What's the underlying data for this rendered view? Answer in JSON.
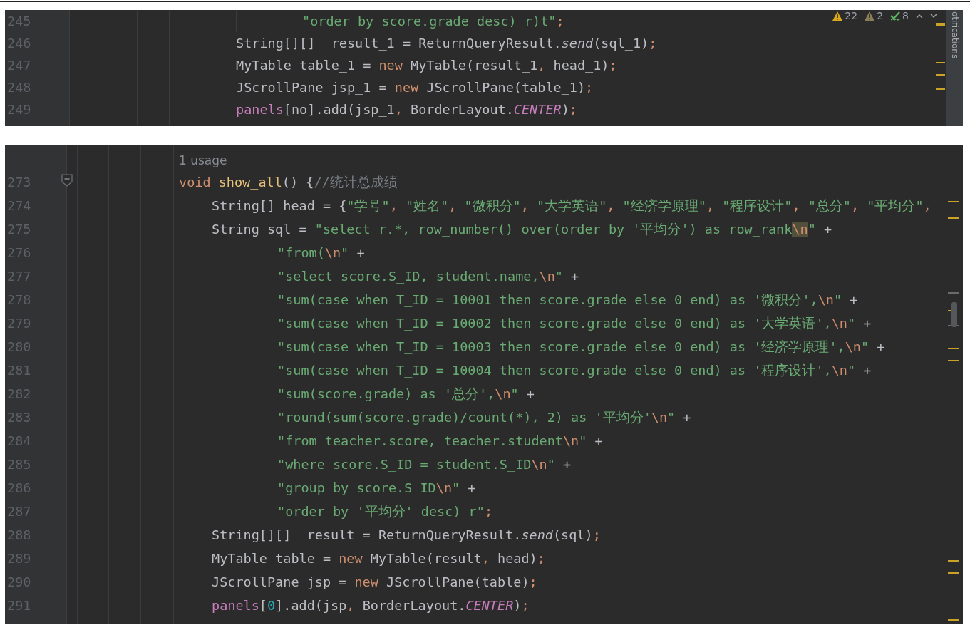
{
  "panels": [
    {
      "side_tab": "otifications",
      "inspections": [
        {
          "kind": "warning",
          "count": "22"
        },
        {
          "kind": "weak_warning",
          "count": "2"
        },
        {
          "kind": "typo",
          "count": "8"
        }
      ],
      "lines": [
        {
          "number": "245",
          "kind": "cont",
          "tokens": [
            {
              "text": "\"order by score.grade desc) r)t\"",
              "kind": "string"
            },
            {
              "text": ";",
              "kind": "punct"
            }
          ]
        },
        {
          "number": "246",
          "kind": "body",
          "tokens": [
            {
              "text": "String[][]  result_1 = ReturnQueryResult.",
              "kind": "plain"
            },
            {
              "text": "send",
              "kind": "static_call"
            },
            {
              "text": "(sql_1)",
              "kind": "plain"
            },
            {
              "text": ";",
              "kind": "punct"
            }
          ]
        },
        {
          "number": "247",
          "kind": "body",
          "tokens": [
            {
              "text": "MyTable table_1 = ",
              "kind": "plain"
            },
            {
              "text": "new",
              "kind": "keyword"
            },
            {
              "text": " MyTable(result_1",
              "kind": "plain"
            },
            {
              "text": ", ",
              "kind": "punct"
            },
            {
              "text": "head_1)",
              "kind": "plain"
            },
            {
              "text": ";",
              "kind": "punct"
            }
          ]
        },
        {
          "number": "248",
          "kind": "body",
          "tokens": [
            {
              "text": "JScrollPane jsp_1 = ",
              "kind": "plain"
            },
            {
              "text": "new",
              "kind": "keyword"
            },
            {
              "text": " JScrollPane(table_1)",
              "kind": "plain"
            },
            {
              "text": ";",
              "kind": "punct"
            }
          ]
        },
        {
          "number": "249",
          "kind": "body",
          "tokens": [
            {
              "text": "panels",
              "kind": "field"
            },
            {
              "text": "[no].add(jsp_1",
              "kind": "plain"
            },
            {
              "text": ", ",
              "kind": "punct"
            },
            {
              "text": "BorderLayout.",
              "kind": "plain"
            },
            {
              "text": "CENTER",
              "kind": "constant"
            },
            {
              "text": ")",
              "kind": "plain"
            },
            {
              "text": ";",
              "kind": "punct"
            }
          ]
        }
      ]
    },
    {
      "usage_hint": "1 usage",
      "lines": [
        {
          "number": "273",
          "kind": "decl",
          "tokens": [
            {
              "text": "void",
              "kind": "keyword"
            },
            {
              "text": " show_all",
              "kind": "function"
            },
            {
              "text": "() {",
              "kind": "plain"
            },
            {
              "text": "//统计总成绩",
              "kind": "comment"
            }
          ]
        },
        {
          "number": "274",
          "kind": "body",
          "tokens": [
            {
              "text": "String[] head = {",
              "kind": "plain"
            },
            {
              "text": "\"学号\"",
              "kind": "string"
            },
            {
              "text": ", ",
              "kind": "punct"
            },
            {
              "text": "\"姓名\"",
              "kind": "string"
            },
            {
              "text": ", ",
              "kind": "punct"
            },
            {
              "text": "\"微积分\"",
              "kind": "string"
            },
            {
              "text": ", ",
              "kind": "punct"
            },
            {
              "text": "\"大学英语\"",
              "kind": "string"
            },
            {
              "text": ", ",
              "kind": "punct"
            },
            {
              "text": "\"经济学原理\"",
              "kind": "string"
            },
            {
              "text": ", ",
              "kind": "punct"
            },
            {
              "text": "\"程序设计\"",
              "kind": "string"
            },
            {
              "text": ", ",
              "kind": "punct"
            },
            {
              "text": "\"总分\"",
              "kind": "string"
            },
            {
              "text": ", ",
              "kind": "punct"
            },
            {
              "text": "\"平均分\"",
              "kind": "string"
            },
            {
              "text": ",",
              "kind": "punct"
            }
          ]
        },
        {
          "number": "275",
          "kind": "body",
          "tokens": [
            {
              "text": "String sql = ",
              "kind": "plain"
            },
            {
              "text": "\"select r.*, row_number() over(order by '平均分') as row_rank",
              "kind": "string"
            },
            {
              "text": "\\n",
              "kind": "escape_match"
            },
            {
              "text": "\"",
              "kind": "string"
            },
            {
              "text": " +",
              "kind": "plain"
            }
          ]
        },
        {
          "number": "276",
          "kind": "cont",
          "tokens": [
            {
              "text": "\"from(",
              "kind": "string"
            },
            {
              "text": "\\n",
              "kind": "escape"
            },
            {
              "text": "\"",
              "kind": "string"
            },
            {
              "text": " +",
              "kind": "plain"
            }
          ]
        },
        {
          "number": "277",
          "kind": "cont",
          "tokens": [
            {
              "text": "\"select score.S_ID, student.name,",
              "kind": "string"
            },
            {
              "text": "\\n",
              "kind": "escape"
            },
            {
              "text": "\"",
              "kind": "string"
            },
            {
              "text": " +",
              "kind": "plain"
            }
          ]
        },
        {
          "number": "278",
          "kind": "cont",
          "tokens": [
            {
              "text": "\"sum(case when T_ID = 10001 then score.grade else 0 end) as '微积分',",
              "kind": "string"
            },
            {
              "text": "\\n",
              "kind": "escape"
            },
            {
              "text": "\"",
              "kind": "string"
            },
            {
              "text": " +",
              "kind": "plain"
            }
          ]
        },
        {
          "number": "279",
          "kind": "cont",
          "tokens": [
            {
              "text": "\"sum(case when T_ID = 10002 then score.grade else 0 end) as '大学英语',",
              "kind": "string"
            },
            {
              "text": "\\n",
              "kind": "escape"
            },
            {
              "text": "\"",
              "kind": "string"
            },
            {
              "text": " +",
              "kind": "plain"
            }
          ]
        },
        {
          "number": "280",
          "kind": "cont",
          "tokens": [
            {
              "text": "\"sum(case when T_ID = 10003 then score.grade else 0 end) as '经济学原理',",
              "kind": "string"
            },
            {
              "text": "\\n",
              "kind": "escape"
            },
            {
              "text": "\"",
              "kind": "string"
            },
            {
              "text": " +",
              "kind": "plain"
            }
          ]
        },
        {
          "number": "281",
          "kind": "cont",
          "tokens": [
            {
              "text": "\"sum(case when T_ID = 10004 then score.grade else 0 end) as '程序设计',",
              "kind": "string"
            },
            {
              "text": "\\n",
              "kind": "escape"
            },
            {
              "text": "\"",
              "kind": "string"
            },
            {
              "text": " +",
              "kind": "plain"
            }
          ]
        },
        {
          "number": "282",
          "kind": "cont",
          "tokens": [
            {
              "text": "\"sum(score.grade) as '总分',",
              "kind": "string"
            },
            {
              "text": "\\n",
              "kind": "escape"
            },
            {
              "text": "\"",
              "kind": "string"
            },
            {
              "text": " +",
              "kind": "plain"
            }
          ]
        },
        {
          "number": "283",
          "kind": "cont",
          "tokens": [
            {
              "text": "\"round(sum(score.grade)/count(*), 2) as '平均分'",
              "kind": "string"
            },
            {
              "text": "\\n",
              "kind": "escape"
            },
            {
              "text": "\"",
              "kind": "string"
            },
            {
              "text": " +",
              "kind": "plain"
            }
          ]
        },
        {
          "number": "284",
          "kind": "cont",
          "tokens": [
            {
              "text": "\"from teacher.score, teacher.student",
              "kind": "string"
            },
            {
              "text": "\\n",
              "kind": "escape"
            },
            {
              "text": "\"",
              "kind": "string"
            },
            {
              "text": " +",
              "kind": "plain"
            }
          ]
        },
        {
          "number": "285",
          "kind": "cont",
          "tokens": [
            {
              "text": "\"where score.S_ID = student.S_ID",
              "kind": "string"
            },
            {
              "text": "\\n",
              "kind": "escape"
            },
            {
              "text": "\"",
              "kind": "string"
            },
            {
              "text": " +",
              "kind": "plain"
            }
          ]
        },
        {
          "number": "286",
          "kind": "cont",
          "tokens": [
            {
              "text": "\"group by score.S_ID",
              "kind": "string"
            },
            {
              "text": "\\n",
              "kind": "escape"
            },
            {
              "text": "\"",
              "kind": "string"
            },
            {
              "text": " +",
              "kind": "plain"
            }
          ]
        },
        {
          "number": "287",
          "kind": "cont",
          "tokens": [
            {
              "text": "\"order by '平均分' desc) r\"",
              "kind": "string"
            },
            {
              "text": ";",
              "kind": "punct"
            }
          ]
        },
        {
          "number": "288",
          "kind": "body",
          "tokens": [
            {
              "text": "String[][]  result = ReturnQueryResult.",
              "kind": "plain"
            },
            {
              "text": "send",
              "kind": "static_call"
            },
            {
              "text": "(sql)",
              "kind": "plain"
            },
            {
              "text": ";",
              "kind": "punct"
            }
          ]
        },
        {
          "number": "289",
          "kind": "body",
          "tokens": [
            {
              "text": "MyTable table = ",
              "kind": "plain"
            },
            {
              "text": "new",
              "kind": "keyword"
            },
            {
              "text": " MyTable(result",
              "kind": "plain"
            },
            {
              "text": ", ",
              "kind": "punct"
            },
            {
              "text": "head)",
              "kind": "plain"
            },
            {
              "text": ";",
              "kind": "punct"
            }
          ]
        },
        {
          "number": "290",
          "kind": "body",
          "tokens": [
            {
              "text": "JScrollPane jsp = ",
              "kind": "plain"
            },
            {
              "text": "new",
              "kind": "keyword"
            },
            {
              "text": " JScrollPane(table)",
              "kind": "plain"
            },
            {
              "text": ";",
              "kind": "punct"
            }
          ]
        },
        {
          "number": "291",
          "kind": "body",
          "tokens": [
            {
              "text": "panels",
              "kind": "field"
            },
            {
              "text": "[",
              "kind": "plain"
            },
            {
              "text": "0",
              "kind": "number"
            },
            {
              "text": "].add(jsp",
              "kind": "plain"
            },
            {
              "text": ", ",
              "kind": "punct"
            },
            {
              "text": "BorderLayout.",
              "kind": "plain"
            },
            {
              "text": "CENTER",
              "kind": "constant"
            },
            {
              "text": ")",
              "kind": "plain"
            },
            {
              "text": ";",
              "kind": "punct"
            }
          ]
        }
      ]
    }
  ]
}
